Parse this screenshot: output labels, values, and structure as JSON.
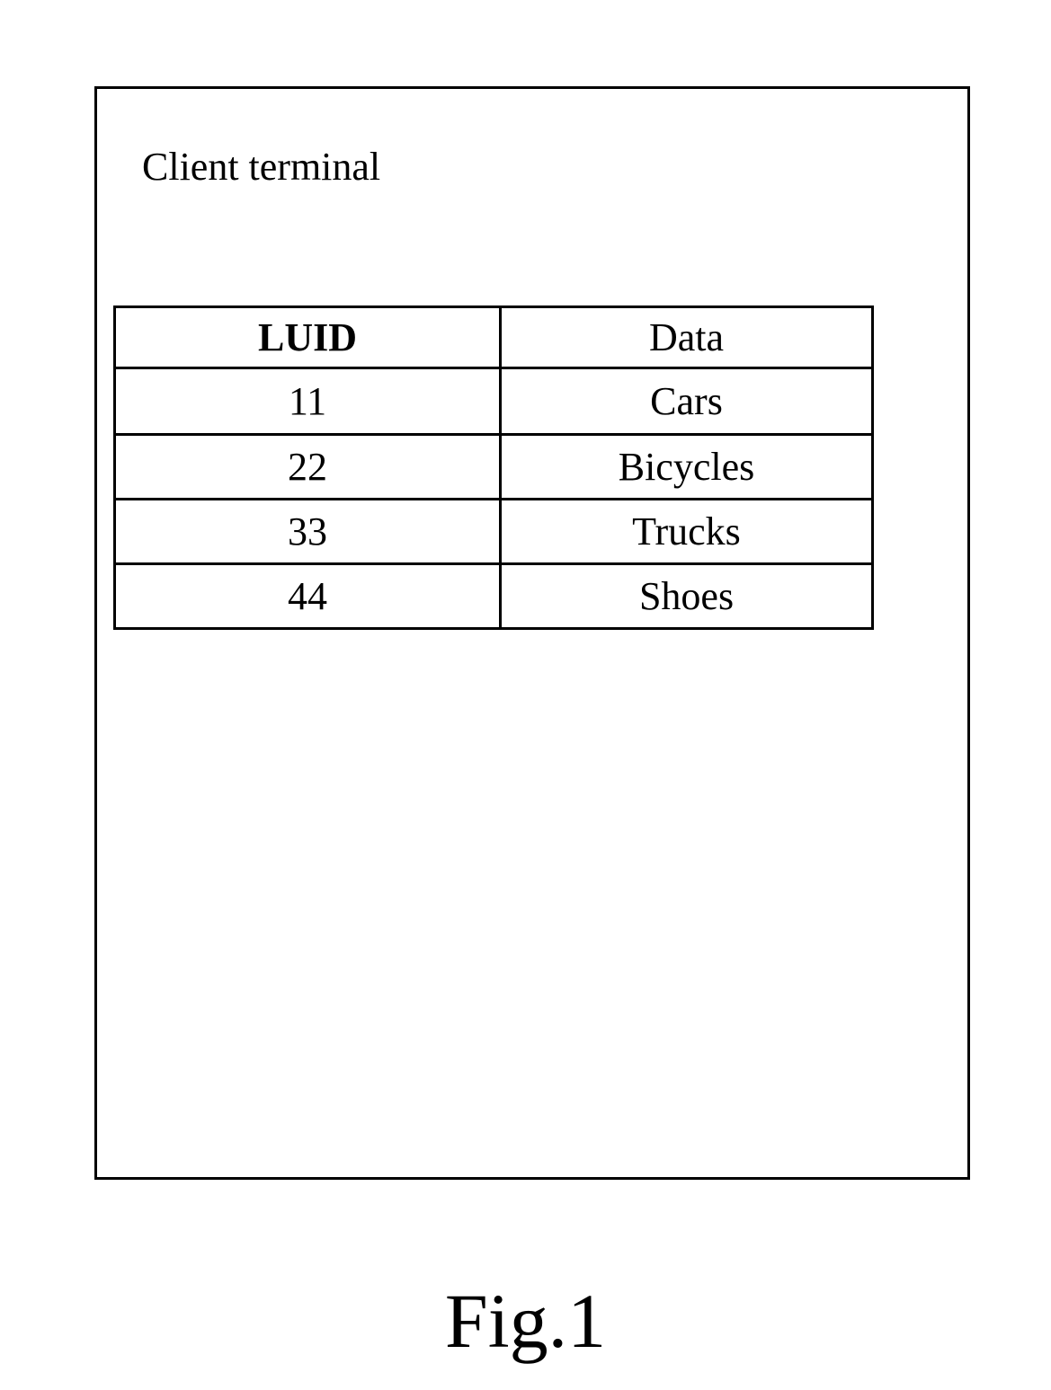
{
  "diagram": {
    "title": "Client terminal",
    "table": {
      "headers": [
        "LUID",
        "Data"
      ],
      "rows": [
        {
          "luid": "11",
          "data": "Cars"
        },
        {
          "luid": "22",
          "data": "Bicycles"
        },
        {
          "luid": "33",
          "data": "Trucks"
        },
        {
          "luid": "44",
          "data": "Shoes"
        }
      ]
    }
  },
  "caption": "Fig.1"
}
